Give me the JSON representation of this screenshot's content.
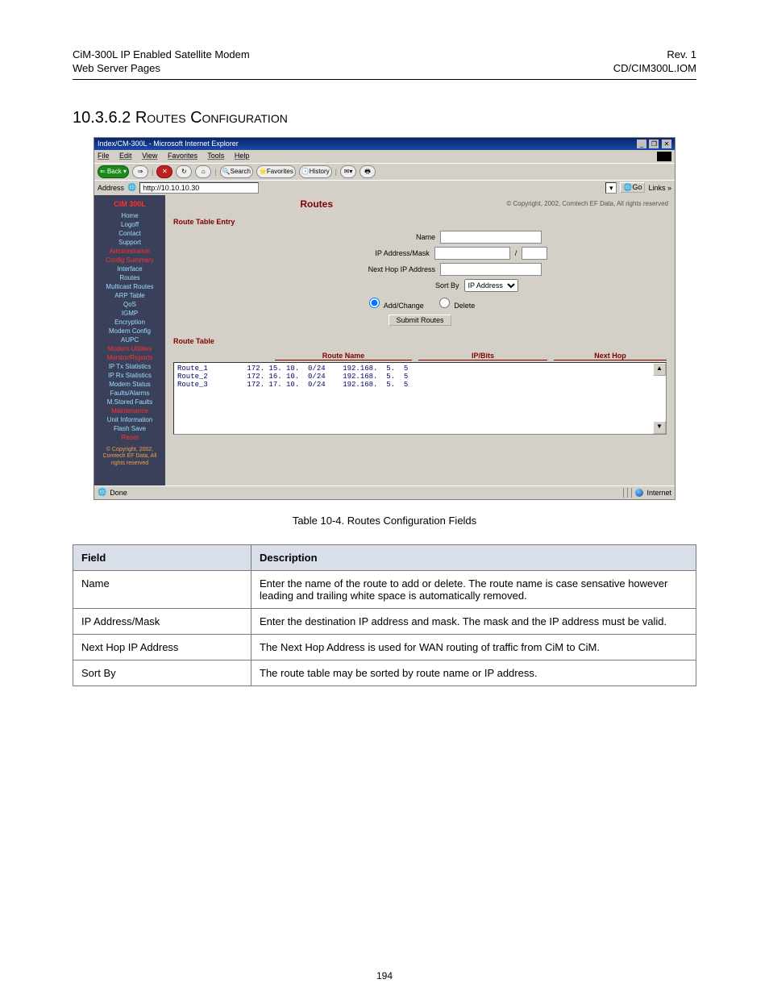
{
  "header": {
    "left_top": "CiM-300L IP Enabled Satellite Modem",
    "left_bottom": "Web Server Pages",
    "right_top": "Rev. 1",
    "right_bottom": "CD/CIM300L.IOM"
  },
  "section_title_num": "10.3.6.2",
  "section_title_text": "Routes Configuration",
  "caption": "Table 10-4.  Routes Configuration Fields",
  "page_number": "194",
  "fields_table": {
    "headers": [
      "Field",
      "Description"
    ],
    "rows": [
      [
        "Name",
        "Enter the name of the route to add or delete.  The route name is case sensative however leading and trailing white space is automatically removed."
      ],
      [
        "IP Address/Mask",
        "Enter the destination IP address and mask.  The mask and the IP address must be valid."
      ],
      [
        "Next Hop IP Address",
        "The Next Hop Address is used for WAN routing of traffic from CiM to CiM."
      ],
      [
        "Sort By",
        "The route table may be sorted by route name or IP address."
      ]
    ]
  },
  "browser": {
    "title": "Index/CM-300L - Microsoft Internet Explorer",
    "win_min": "_",
    "win_max": "❐",
    "win_close": "✕",
    "menus": [
      "File",
      "Edit",
      "View",
      "Favorites",
      "Tools",
      "Help"
    ],
    "toolbar": {
      "back": "⇐ Back ▾",
      "fwd": "⇒",
      "stop": "✕",
      "refresh": "↻",
      "home": "⌂",
      "search": "🔍Search",
      "fav": "⭐Favorites",
      "history": "🕓History",
      "mail": "✉▾",
      "print": "🖶"
    },
    "address_label": "Address",
    "address_icon": "🌐",
    "address_value": "http://10.10.10.30",
    "go_label": "Go",
    "links_label": "Links »",
    "status_left": "Done",
    "status_right": "Internet"
  },
  "sidebar": {
    "brand": "CiM 300L",
    "items": [
      {
        "label": "Home",
        "hdr": false
      },
      {
        "label": "Logoff",
        "hdr": false
      },
      {
        "label": "Contact",
        "hdr": false
      },
      {
        "label": "Support",
        "hdr": false
      },
      {
        "label": "Administration",
        "hdr": true
      },
      {
        "label": "Config Summary",
        "hdr": true
      },
      {
        "label": "Interface",
        "hdr": false
      },
      {
        "label": "Routes",
        "hdr": false
      },
      {
        "label": "Multicast Routes",
        "hdr": false
      },
      {
        "label": "ARP Table",
        "hdr": false
      },
      {
        "label": "QoS",
        "hdr": false
      },
      {
        "label": "IGMP",
        "hdr": false
      },
      {
        "label": "Encryption",
        "hdr": false
      },
      {
        "label": "Modem Config",
        "hdr": false
      },
      {
        "label": "AUPC",
        "hdr": false
      },
      {
        "label": "Modem Utilities",
        "hdr": true
      },
      {
        "label": "Monitor/Reports",
        "hdr": true
      },
      {
        "label": "IP Tx Statistics",
        "hdr": false
      },
      {
        "label": "IP Rx Statistics",
        "hdr": false
      },
      {
        "label": "Modem Status",
        "hdr": false
      },
      {
        "label": "Faults/Alarms",
        "hdr": false
      },
      {
        "label": "M.Stored Faults",
        "hdr": false
      },
      {
        "label": "Maintenance",
        "hdr": true
      },
      {
        "label": "Unit Information",
        "hdr": false
      },
      {
        "label": "Flash Save",
        "hdr": false
      },
      {
        "label": "Reset",
        "hdr": true
      }
    ],
    "copyright": "© Copyright, 2002, Comtech EF Data, All rights reserved"
  },
  "mainpane": {
    "title": "Routes",
    "copyright": "© Copyright, 2002, Comtech EF Data, All rights reserved",
    "entry_legend": "Route Table Entry",
    "labels": {
      "name": "Name",
      "ipmask": "IP Address/Mask",
      "nexthop": "Next Hop IP Address",
      "sortby": "Sort By"
    },
    "sortby_options": [
      "IP Address"
    ],
    "sortby_selected": "IP Address",
    "radio_addchange": "Add/Change",
    "radio_delete": "Delete",
    "submit": "Submit Routes",
    "table_legend": "Route Table",
    "table_headers": [
      "Route Name",
      "IP/Bits",
      "Next Hop"
    ],
    "route_rows": [
      {
        "name": "Route_1",
        "ip": "172. 15. 10.  0/24",
        "nh": "192.168.  5.  5"
      },
      {
        "name": "Route_2",
        "ip": "172. 16. 10.  0/24",
        "nh": "192.168.  5.  5"
      },
      {
        "name": "Route_3",
        "ip": "172. 17. 10.  0/24",
        "nh": "192.168.  5.  5"
      }
    ],
    "scroll_up": "▲",
    "scroll_down": "▼"
  }
}
